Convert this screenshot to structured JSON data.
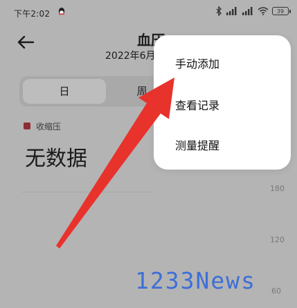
{
  "status_bar": {
    "time": "下午2:02",
    "battery": "39"
  },
  "header": {
    "title": "血压",
    "date": "2022年6月"
  },
  "tabs": [
    {
      "label": "日"
    },
    {
      "label": "周"
    }
  ],
  "legend": {
    "label": "收缩压",
    "color": "#8e2c34"
  },
  "summary": {
    "value": "无数据"
  },
  "axis": {
    "ticks": [
      "180",
      "120",
      "60"
    ]
  },
  "menu": {
    "items": [
      {
        "label": "手动添加"
      },
      {
        "label": "查看记录"
      },
      {
        "label": "测量提醒"
      }
    ]
  },
  "overlay": {
    "arrow_color": "#e8322c"
  },
  "watermark": {
    "text": "1233News"
  },
  "icons": {
    "back": "back-arrow-icon",
    "qq": "qq-icon",
    "bluetooth": "bluetooth-icon",
    "signal": "signal-icon",
    "wifi": "wifi-icon",
    "battery": "battery-icon"
  }
}
